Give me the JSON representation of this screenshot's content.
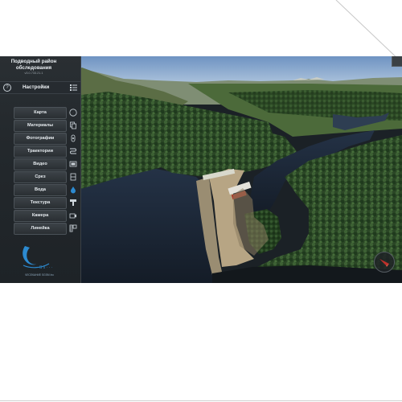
{
  "project": {
    "title": "Подводный район обследования",
    "version": "v3.0.733.21.1"
  },
  "settings": {
    "label": "Настройки",
    "help_icon": "help-icon",
    "list_icon": "list-icon"
  },
  "menu": {
    "items": [
      {
        "label": "Карта",
        "icon": "compass-icon"
      },
      {
        "label": "Материалы",
        "icon": "copy-icon"
      },
      {
        "label": "Фотографии",
        "icon": "camera-icon"
      },
      {
        "label": "Траектории",
        "icon": "trajectory-icon"
      },
      {
        "label": "Видео",
        "icon": "video-icon"
      },
      {
        "label": "Срез",
        "icon": "slice-icon"
      },
      {
        "label": "Вода",
        "icon": "water-drop-icon"
      },
      {
        "label": "Текстура",
        "icon": "texture-icon"
      },
      {
        "label": "Камера",
        "icon": "camera-move-icon"
      },
      {
        "label": "Линейка",
        "icon": "ruler-icon"
      }
    ]
  },
  "logo": {
    "caption": "ЧЕСЕКАНИЕ SGSM Inc"
  },
  "colors": {
    "sidebar_bg": "#23282c",
    "button_bg": "#33393e",
    "water": "#1c2a3a",
    "forest": "#2c4a2a",
    "accent_red": "#c0302a",
    "logo_blue": "#2c8ad0"
  }
}
